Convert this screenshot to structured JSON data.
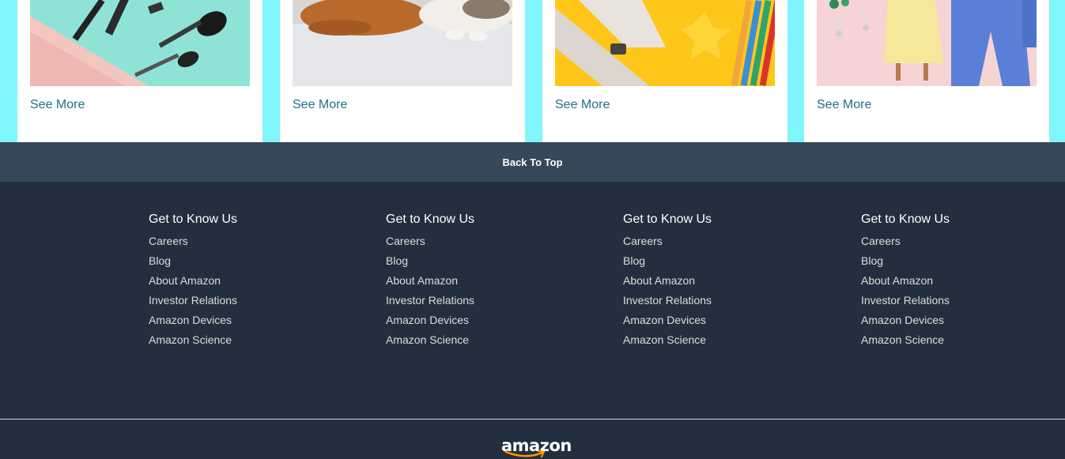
{
  "cards": [
    {
      "image": "cosmetics-makeup-brushes-pouch",
      "see_more": "See More"
    },
    {
      "image": "dog-and-cat-pets",
      "see_more": "See More"
    },
    {
      "image": "toy-airplane-and-colored-pencils",
      "see_more": "See More"
    },
    {
      "image": "fashion-outfits-dresses",
      "see_more": "See More"
    }
  ],
  "back_to_top": "Back To Top",
  "footer": {
    "columns": [
      {
        "heading": "Get to Know Us",
        "links": [
          "Careers",
          "Blog",
          "About Amazon",
          "Investor Relations",
          "Amazon Devices",
          "Amazon Science"
        ]
      },
      {
        "heading": "Get to Know Us",
        "links": [
          "Careers",
          "Blog",
          "About Amazon",
          "Investor Relations",
          "Amazon Devices",
          "Amazon Science"
        ]
      },
      {
        "heading": "Get to Know Us",
        "links": [
          "Careers",
          "Blog",
          "About Amazon",
          "Investor Relations",
          "Amazon Devices",
          "Amazon Science"
        ]
      },
      {
        "heading": "Get to Know Us",
        "links": [
          "Careers",
          "Blog",
          "About Amazon",
          "Investor Relations",
          "Amazon Devices",
          "Amazon Science"
        ]
      }
    ],
    "logo_text": "amazon"
  },
  "colors": {
    "page_bg": "#7ff5fc",
    "back_to_top_bg": "#37475a",
    "footer_bg": "#232f3e",
    "link": "#1f6f86",
    "logo_smile": "#ff9900"
  }
}
